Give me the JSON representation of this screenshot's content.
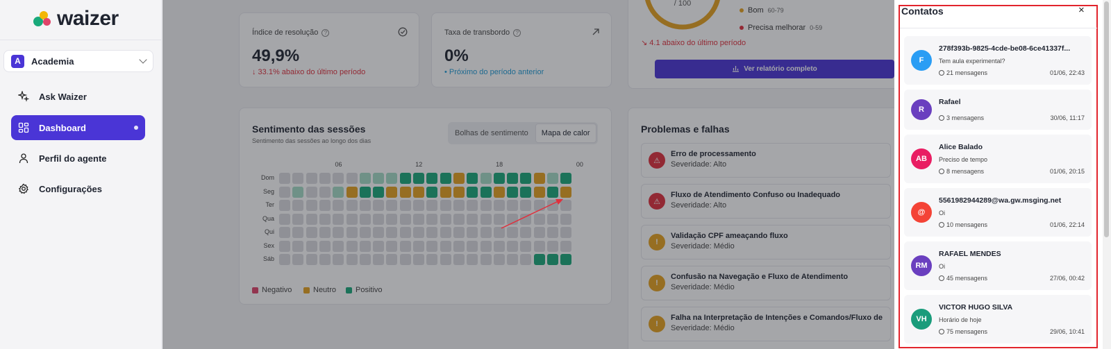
{
  "brand": {
    "name": "waizer"
  },
  "workspace": {
    "badge": "A",
    "name": "Academia"
  },
  "nav": [
    {
      "label": "Ask Waizer",
      "icon": "sparkle-icon",
      "active": false
    },
    {
      "label": "Dashboard",
      "icon": "grid-icon",
      "active": true
    },
    {
      "label": "Perfil do agente",
      "icon": "user-icon",
      "active": false
    },
    {
      "label": "Configurações",
      "icon": "gear-icon",
      "active": false
    }
  ],
  "kpis": [
    {
      "title": "Índice de resolução",
      "value": "49,9%",
      "delta": "↓ 33.1% abaixo do último período",
      "tone": "red",
      "icon": "check-circle-icon"
    },
    {
      "title": "Taxa de transbordo",
      "value": "0%",
      "delta": "• Próximo do período anterior",
      "tone": "blue",
      "icon": "arrow-up-right-icon"
    }
  ],
  "score": {
    "gauge_text": "/ 100",
    "legend": [
      {
        "label": "Bom",
        "range": "60-79",
        "color": "#e7a21f"
      },
      {
        "label": "Precisa melhorar",
        "range": "0-59",
        "color": "#e0303d"
      }
    ],
    "delta": "↘ 4.1 abaixo do último período",
    "button": "Ver relatório completo"
  },
  "sentiment": {
    "title": "Sentimento das sessões",
    "subtitle": "Sentimento das sessões ao longo dos dias",
    "toggle": [
      "Bolhas de sentimento",
      "Mapa de calor"
    ],
    "hours": [
      "06",
      "12",
      "18",
      "00"
    ],
    "days": [
      "Dom",
      "Seg",
      "Ter",
      "Qua",
      "Qui",
      "Sex",
      "Sáb"
    ],
    "legend": [
      {
        "label": "Negativo",
        "color": "#e0446a"
      },
      {
        "label": "Neutro",
        "color": "#e7a21f"
      },
      {
        "label": "Positivo",
        "color": "#19a97a"
      }
    ],
    "grid_codes": [
      "000000LLLPPPPNPLPPPNLP",
      "0L00LNPPNNNPNNPPNPPNPN",
      "0000000000000000000000",
      "0000000000000000000000",
      "0000000000000000000000",
      "0000000000000000000000",
      "0000000000000000000PPP"
    ],
    "colors": {
      "0": "#dadbe0",
      "L": "#a5dcc6",
      "P": "#19a97a",
      "N": "#e7a21f",
      "M": "#f0cf8c"
    }
  },
  "problems": {
    "title": "Problemas e falhas",
    "items": [
      {
        "title": "Erro de processamento",
        "severity": "Severidade: Alto",
        "level": "high"
      },
      {
        "title": "Fluxo de Atendimento Confuso ou Inadequado",
        "severity": "Severidade: Alto",
        "level": "high"
      },
      {
        "title": "Validação CPF ameaçando fluxo",
        "severity": "Severidade: Médio",
        "level": "medium"
      },
      {
        "title": "Confusão na Navegação e Fluxo de Atendimento",
        "severity": "Severidade: Médio",
        "level": "medium"
      },
      {
        "title": "Falha na Interpretação de Intenções e Comandos/Fluxo de",
        "severity": "Severidade: Médio",
        "level": "medium"
      }
    ]
  },
  "contacts": {
    "title": "Contatos",
    "close": "×",
    "items": [
      {
        "initials": "F",
        "color": "#2a9df4",
        "name": "278f393b-9825-4cde-be08-6ce41337f...",
        "message": "Tem aula experimental?",
        "count": "21 mensagens",
        "time": "01/06, 22:43"
      },
      {
        "initials": "R",
        "color": "#6a3fbf",
        "name": "Rafael",
        "message": "",
        "count": "3 mensagens",
        "time": "30/06, 11:17"
      },
      {
        "initials": "AB",
        "color": "#e91e63",
        "name": "Alice Balado",
        "message": "Preciso de tempo",
        "count": "8 mensagens",
        "time": "01/06, 20:15"
      },
      {
        "initials": "@",
        "color": "#f44336",
        "name": "5561982944289@wa.gw.msging.net",
        "message": "Oi",
        "count": "10 mensagens",
        "time": "01/06, 22:14"
      },
      {
        "initials": "RM",
        "color": "#6a3fbf",
        "name": "RAFAEL MENDES",
        "message": "Oi",
        "count": "45 mensagens",
        "time": "27/06, 00:42"
      },
      {
        "initials": "VH",
        "color": "#1a9c7b",
        "name": "VICTOR HUGO SILVA",
        "message": "Horário de hoje",
        "count": "75 mensagens",
        "time": "29/06, 10:41"
      }
    ]
  }
}
